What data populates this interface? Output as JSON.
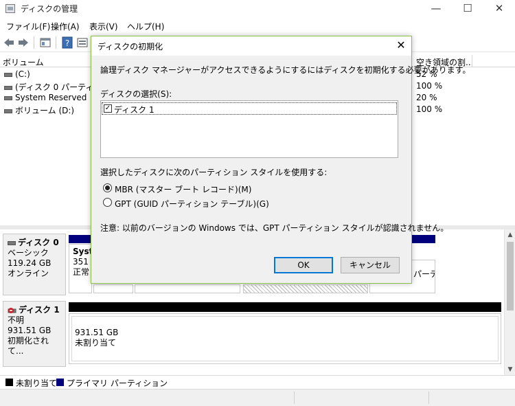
{
  "window": {
    "title": "ディスクの管理",
    "minimize": "—",
    "maximize": "☐",
    "close": "✕"
  },
  "menu": {
    "file": "ファイル(F)",
    "action": "操作(A)",
    "view": "表示(V)",
    "help": "ヘルプ(H)"
  },
  "volume_list": {
    "headers": [
      "ボリューム",
      "空き領域の割..."
    ],
    "rows": [
      {
        "name": "(C:)",
        "free_pct": "52 %"
      },
      {
        "name": "(ディスク 0 パーティシ...",
        "free_pct": "100 %"
      },
      {
        "name": "System Reserved",
        "free_pct": "20 %"
      },
      {
        "name": "ボリューム (D:)",
        "free_pct": "100 %"
      }
    ]
  },
  "disks": [
    {
      "name": "ディスク 0",
      "type": "ベーシック",
      "size": "119.24 GB",
      "status": "オンライン",
      "partition_name": "Syste",
      "partition_size": "351 M",
      "partition_status": "正常",
      "right_partition_text": "パーテ·"
    },
    {
      "name": "ディスク 1",
      "type": "不明",
      "size": "931.51 GB",
      "status": "初期化されて...",
      "space_size": "931.51 GB",
      "space_status": "未割り当て"
    }
  ],
  "legend": {
    "unallocated": "未割り当て",
    "primary": "プライマリ パーティション"
  },
  "dialog": {
    "title": "ディスクの初期化",
    "close": "✕",
    "message": "論理ディスク マネージャーがアクセスできるようにするにはディスクを初期化する必要があります。",
    "select_label": "ディスクの選択(S):",
    "disk_item": "ディスク 1",
    "checkmark": "✓",
    "style_label": "選択したディスクに次のパーティション スタイルを使用する:",
    "mbr_label": "MBR (マスター ブート レコード)(M)",
    "gpt_label": "GPT (GUID パーティション テーブル)(G)",
    "note": "注意: 以前のバージョンの Windows では、GPT パーティション スタイルが認識されません。",
    "ok": "OK",
    "cancel": "キャンセル"
  },
  "colors": {
    "primary_partition": "#00007c",
    "unallocated": "#000000",
    "dialog_border": "#8bbf4a",
    "default_button_border": "#0078d7"
  }
}
